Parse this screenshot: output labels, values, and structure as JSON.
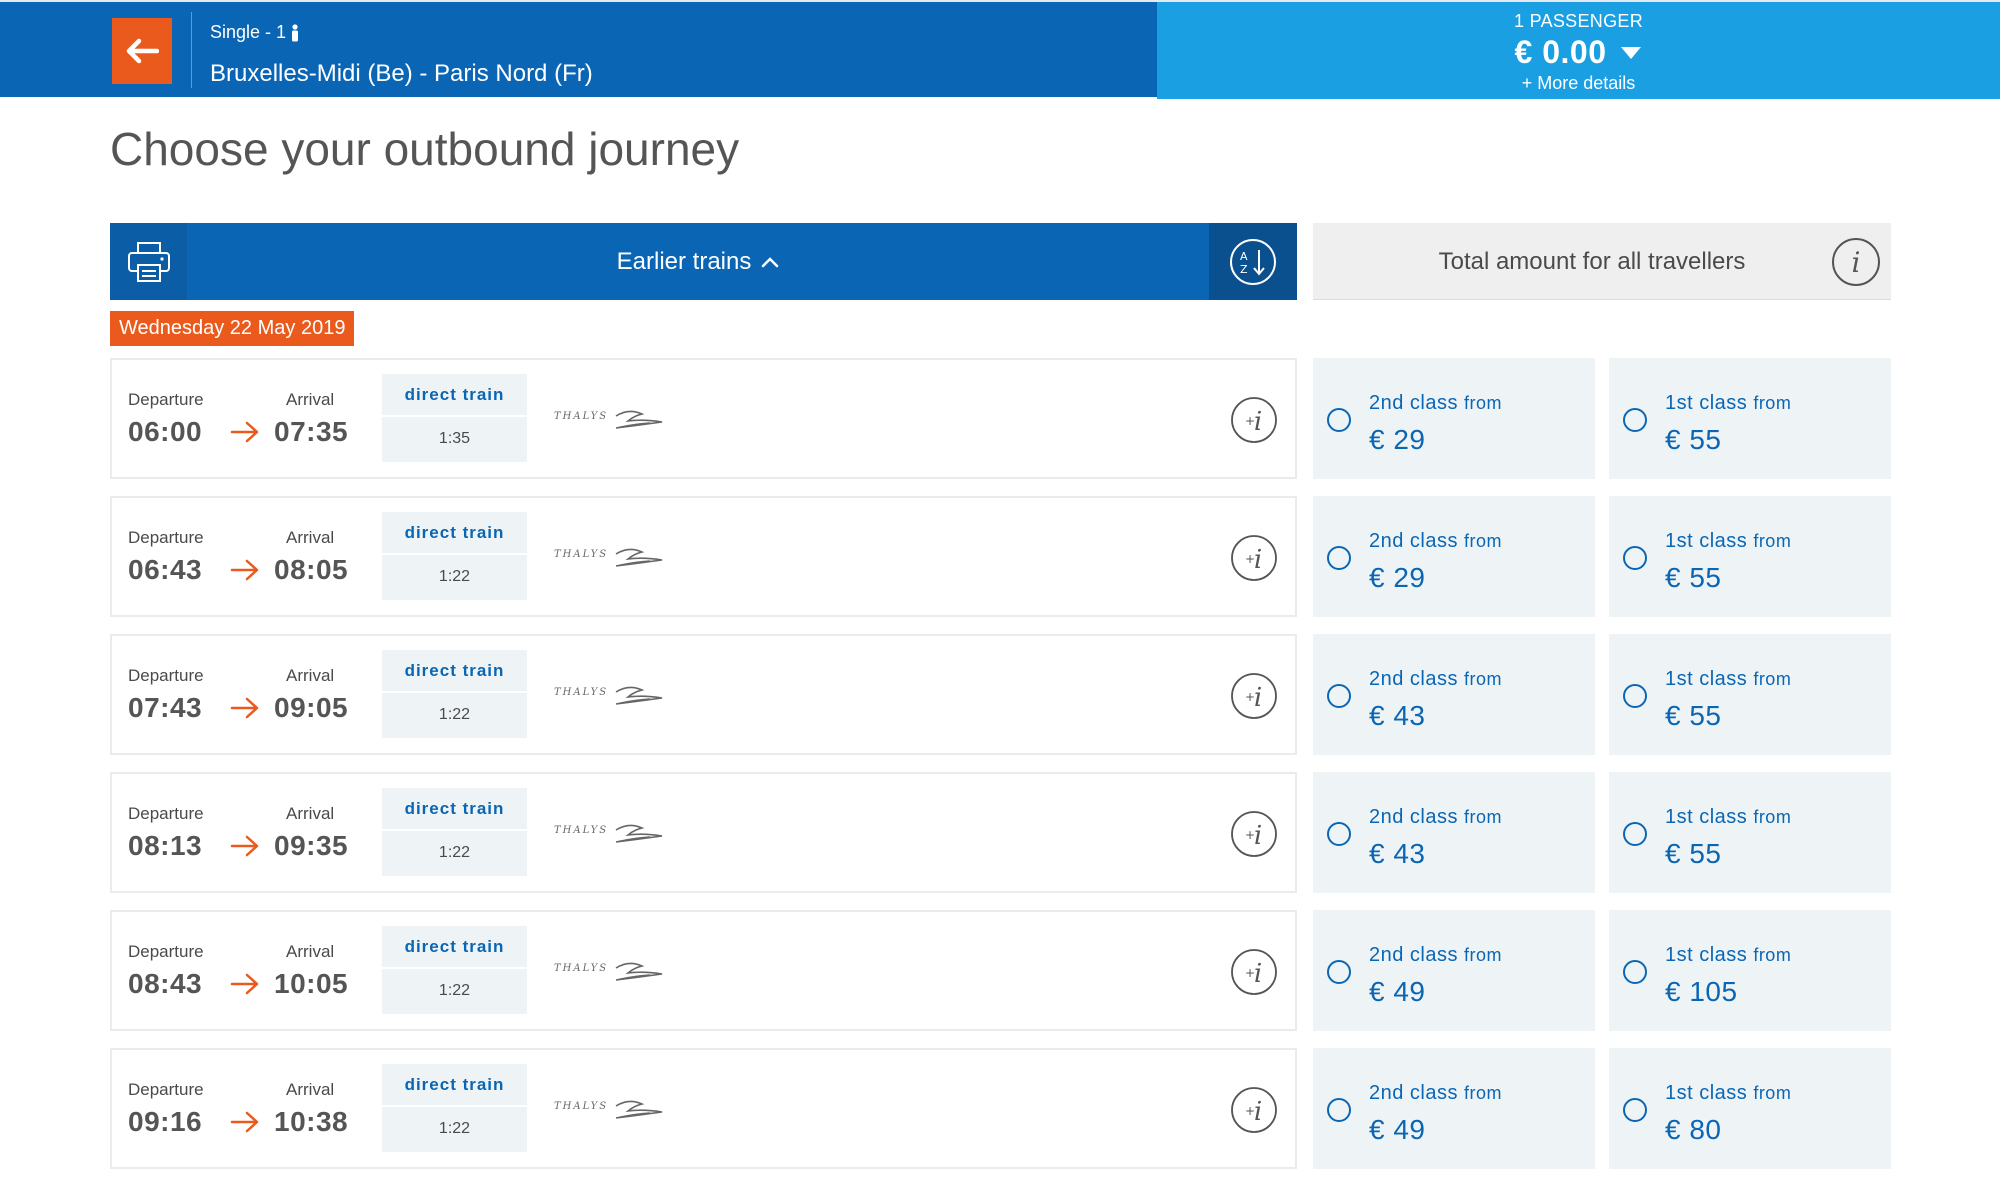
{
  "header": {
    "trip_type": "Single - 1",
    "route": "Bruxelles-Midi (Be) - Paris Nord (Fr)",
    "passengers": "1 PASSENGER",
    "total_price": "€ 0.00",
    "more_details": "+ More details"
  },
  "page_title": "Choose your outbound journey",
  "toolbar": {
    "earlier_trains": "Earlier trains",
    "total_label": "Total amount for all travellers"
  },
  "date": "Wednesday 22 May 2019",
  "labels": {
    "departure": "Departure",
    "arrival": "Arrival",
    "second_class": "2nd class",
    "first_class": "1st class",
    "from": "from",
    "operator": "THALYS"
  },
  "journeys": [
    {
      "departure": "06:00",
      "arrival": "07:35",
      "type": "direct train",
      "duration": "1:35",
      "second_price": "€ 29",
      "first_price": "€ 55"
    },
    {
      "departure": "06:43",
      "arrival": "08:05",
      "type": "direct train",
      "duration": "1:22",
      "second_price": "€ 29",
      "first_price": "€ 55"
    },
    {
      "departure": "07:43",
      "arrival": "09:05",
      "type": "direct train",
      "duration": "1:22",
      "second_price": "€ 43",
      "first_price": "€ 55"
    },
    {
      "departure": "08:13",
      "arrival": "09:35",
      "type": "direct train",
      "duration": "1:22",
      "second_price": "€ 43",
      "first_price": "€ 55"
    },
    {
      "departure": "08:43",
      "arrival": "10:05",
      "type": "direct train",
      "duration": "1:22",
      "second_price": "€ 49",
      "first_price": "€ 105"
    },
    {
      "departure": "09:16",
      "arrival": "10:38",
      "type": "direct train",
      "duration": "1:22",
      "second_price": "€ 49",
      "first_price": "€ 80"
    }
  ],
  "colors": {
    "primary_blue": "#0a66b5",
    "light_blue": "#1a9fe3",
    "orange": "#ea5a1c",
    "fare_bg": "#eef4f5"
  }
}
